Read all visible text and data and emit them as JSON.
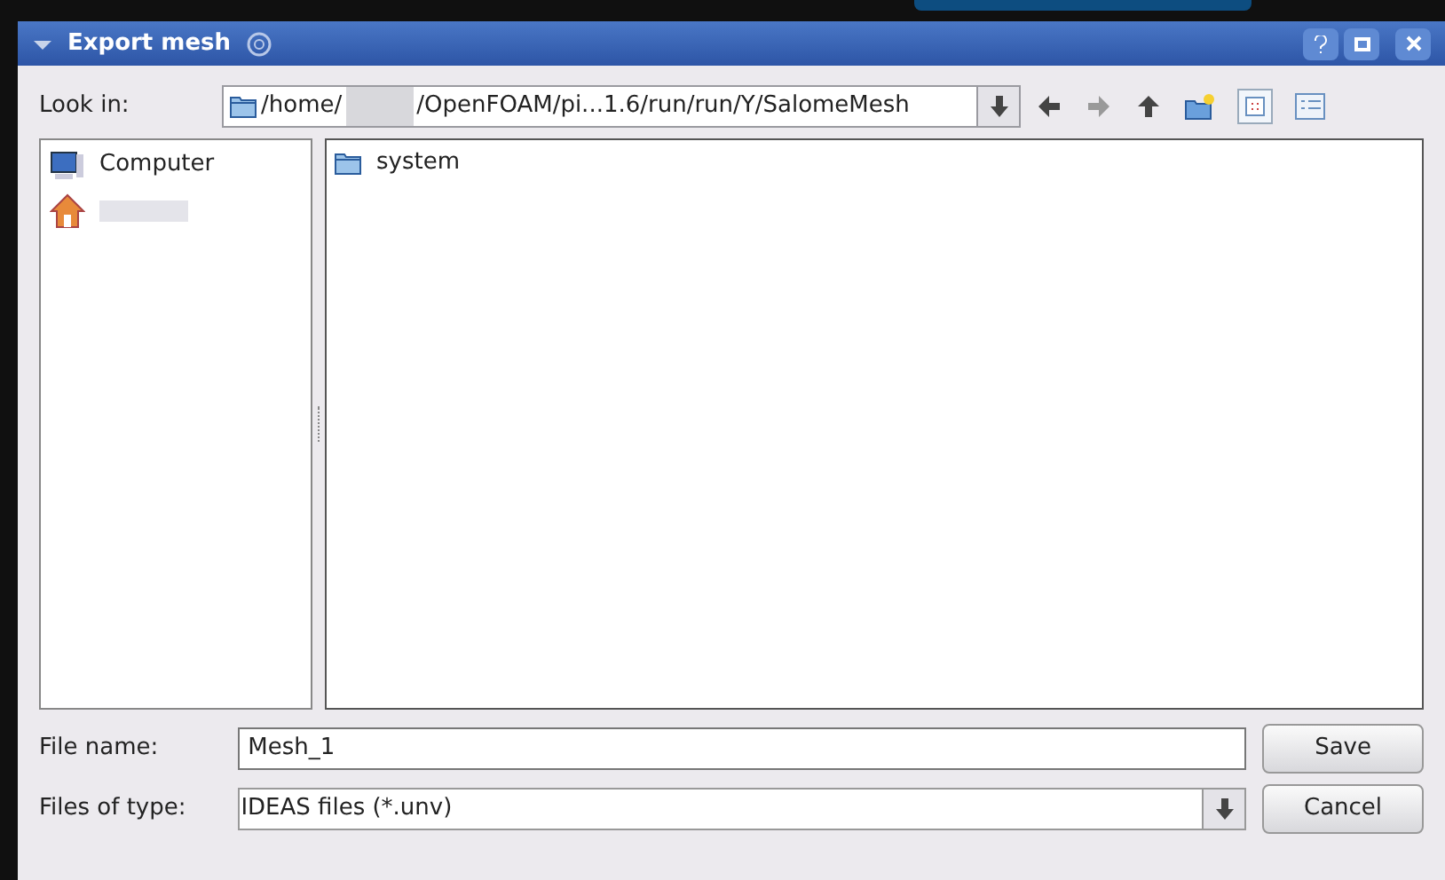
{
  "window": {
    "title": "Export mesh"
  },
  "look_in": {
    "label": "Look in:",
    "path_start": "/home/",
    "path_end": "/OpenFOAM/pi...1.6/run/run/Y/SalomeMesh"
  },
  "sidebar": {
    "items": [
      {
        "kind": "computer",
        "label": "Computer"
      },
      {
        "kind": "home"
      }
    ]
  },
  "files": [
    {
      "name": "system"
    }
  ],
  "file_name": {
    "label": "File name:",
    "value": "Mesh_1"
  },
  "file_type": {
    "label": "Files of type:",
    "value": "IDEAS files (*.unv)"
  },
  "buttons": [
    "Save",
    "Cancel"
  ]
}
